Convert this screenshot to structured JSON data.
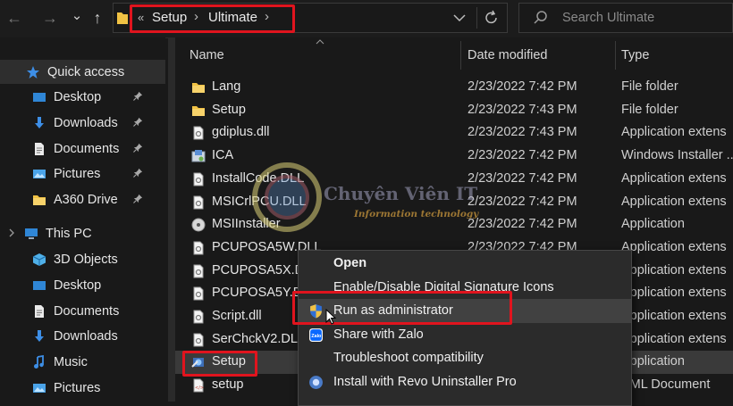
{
  "toolbar": {
    "back_glyph": "←",
    "forward_glyph": "→",
    "recent_glyph": "⌄",
    "up_glyph": "↑"
  },
  "address": {
    "overflow": "«",
    "crumbs": [
      "Setup",
      "Ultimate"
    ],
    "separator": "›"
  },
  "search": {
    "placeholder": "Search Ultimate"
  },
  "sidebar": {
    "items": [
      {
        "label": "Quick access",
        "icon": "star-icon",
        "pinned": false
      },
      {
        "label": "Desktop",
        "icon": "desktop-icon",
        "pinned": true
      },
      {
        "label": "Downloads",
        "icon": "download-icon",
        "pinned": true
      },
      {
        "label": "Documents",
        "icon": "documents-icon",
        "pinned": true
      },
      {
        "label": "Pictures",
        "icon": "pictures-icon",
        "pinned": true
      },
      {
        "label": "A360 Drive",
        "icon": "folder-icon",
        "pinned": true
      },
      {
        "label": "This PC",
        "icon": "computer-icon",
        "pinned": false
      },
      {
        "label": "3D Objects",
        "icon": "cube-icon",
        "pinned": false
      },
      {
        "label": "Desktop",
        "icon": "desktop-icon",
        "pinned": false
      },
      {
        "label": "Documents",
        "icon": "documents-icon",
        "pinned": false
      },
      {
        "label": "Downloads",
        "icon": "download-icon",
        "pinned": false
      },
      {
        "label": "Music",
        "icon": "music-icon",
        "pinned": false
      },
      {
        "label": "Pictures",
        "icon": "pictures-icon",
        "pinned": false
      }
    ]
  },
  "columns": {
    "name": "Name",
    "date": "Date modified",
    "type": "Type"
  },
  "files": [
    {
      "name": "Lang",
      "date": "2/23/2022 7:42 PM",
      "type": "File folder",
      "icon": "folder-icon"
    },
    {
      "name": "Setup",
      "date": "2/23/2022 7:43 PM",
      "type": "File folder",
      "icon": "folder-icon"
    },
    {
      "name": "gdiplus.dll",
      "date": "2/23/2022 7:43 PM",
      "type": "Application extens",
      "icon": "dll-file-icon"
    },
    {
      "name": "ICA",
      "date": "2/23/2022 7:42 PM",
      "type": "Windows Installer ...",
      "icon": "installer-icon"
    },
    {
      "name": "InstallCode.DLL",
      "date": "2/23/2022 7:42 PM",
      "type": "Application extens",
      "icon": "dll-file-icon"
    },
    {
      "name": "MSICrlPCU.DLL",
      "date": "2/23/2022 7:42 PM",
      "type": "Application extens",
      "icon": "dll-file-icon"
    },
    {
      "name": "MSIInstaller",
      "date": "2/23/2022 7:42 PM",
      "type": "Application",
      "icon": "disc-icon"
    },
    {
      "name": "PCUPOSA5W.DLL",
      "date": "2/23/2022 7:42 PM",
      "type": "Application extens",
      "icon": "dll-file-icon"
    },
    {
      "name": "PCUPOSA5X.DLL",
      "date": "",
      "type": "Application extens",
      "icon": "dll-file-icon"
    },
    {
      "name": "PCUPOSA5Y.DLL",
      "date": "",
      "type": "Application extens",
      "icon": "dll-file-icon"
    },
    {
      "name": "Script.dll",
      "date": "",
      "type": "Application extens",
      "icon": "dll-file-icon"
    },
    {
      "name": "SerChckV2.DLL",
      "date": "",
      "type": "Application extens",
      "icon": "dll-file-icon"
    },
    {
      "name": "Setup",
      "date": "",
      "type": "Application",
      "icon": "setup-app-icon"
    },
    {
      "name": "setup",
      "date": "",
      "type": "XML Document",
      "icon": "xml-file-icon"
    }
  ],
  "context_menu": {
    "items": [
      {
        "label": "Open",
        "bold": true,
        "icon": ""
      },
      {
        "label": "Enable/Disable Digital Signature Icons",
        "bold": false,
        "icon": ""
      },
      {
        "label": "Run as administrator",
        "bold": false,
        "icon": "uac-shield-icon"
      },
      {
        "label": "Share with Zalo",
        "bold": false,
        "icon": "zalo-icon"
      },
      {
        "label": "Troubleshoot compatibility",
        "bold": false,
        "icon": ""
      },
      {
        "label": "Install with Revo Uninstaller Pro",
        "bold": false,
        "icon": "revo-icon"
      }
    ]
  },
  "watermark": {
    "title": "Chuyên Viên IT",
    "subtitle": "Information technology"
  },
  "colors": {
    "highlight": "#e0141e",
    "folder": "#f1c244",
    "accent": "#3d8ee6"
  }
}
